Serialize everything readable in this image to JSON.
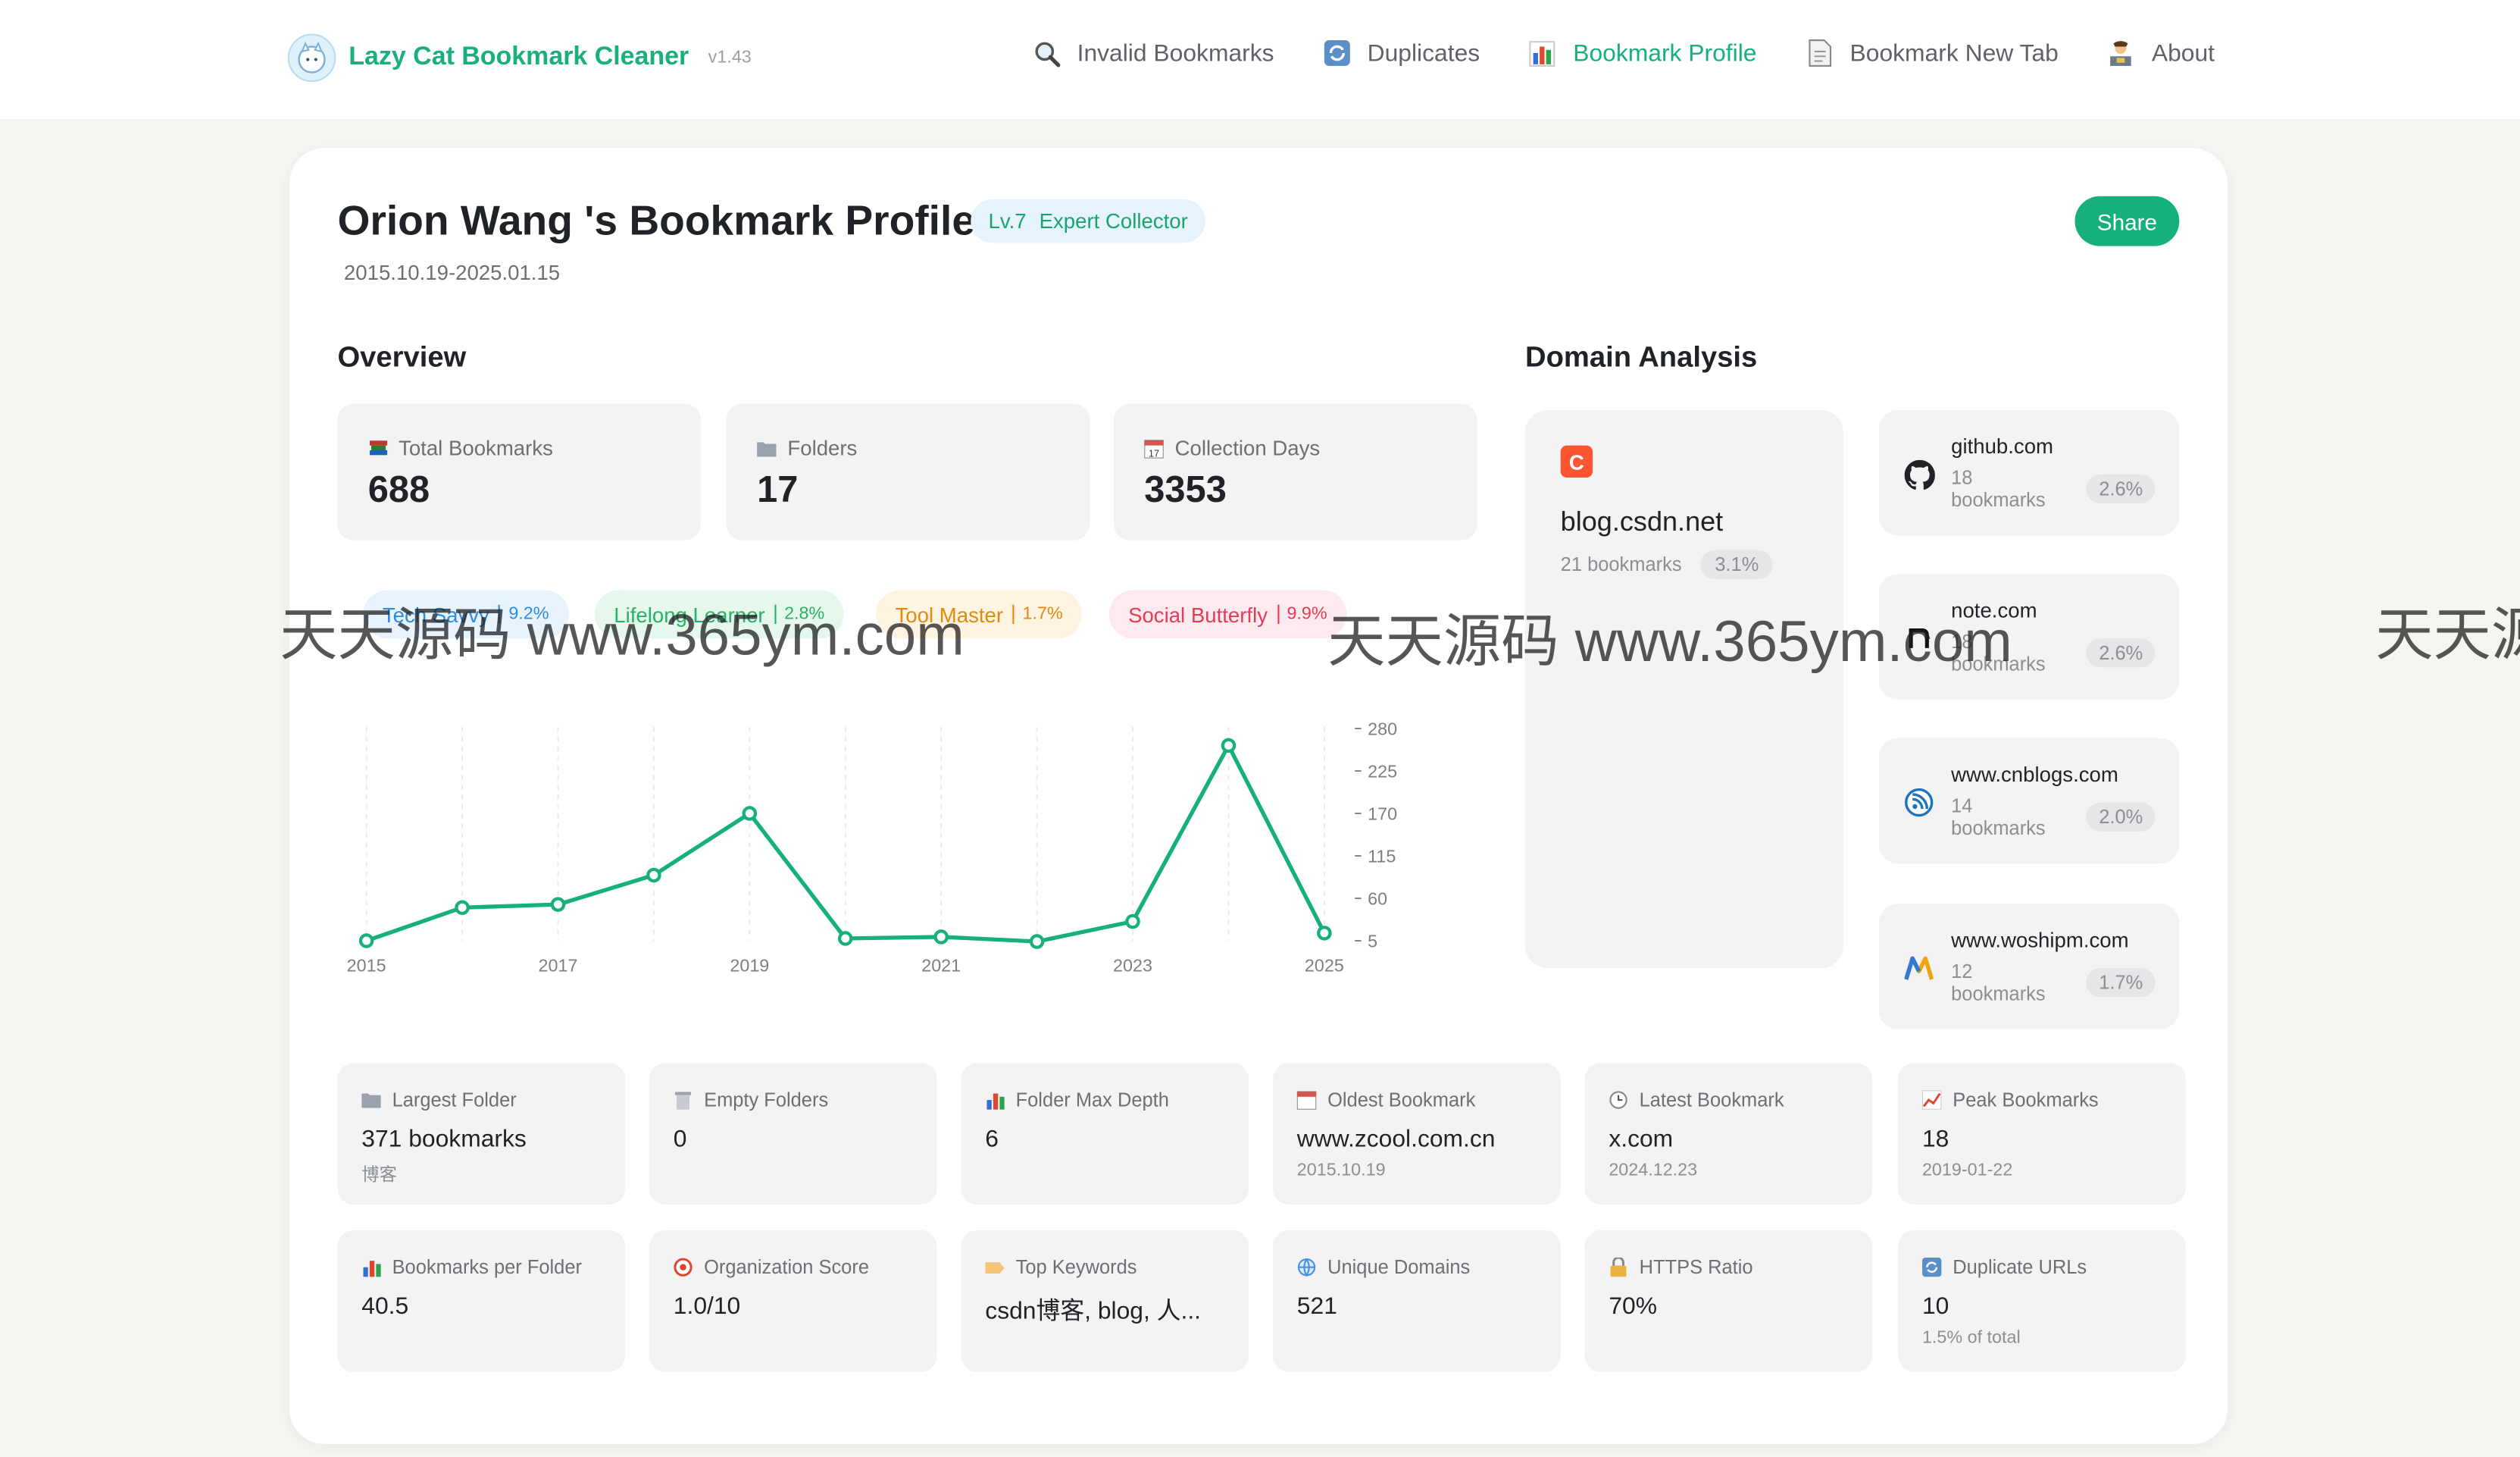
{
  "colors": {
    "accent": "#16b07a",
    "background": "#f6f5f2",
    "card": "#ffffff",
    "tile": "#f3f3f4"
  },
  "header": {
    "app_name": "Lazy Cat Bookmark Cleaner",
    "version": "v1.43",
    "logo_icon": "cat-mascot-icon",
    "nav": [
      {
        "label": "Invalid Bookmarks",
        "icon": "magnifier-icon",
        "active": false
      },
      {
        "label": "Duplicates",
        "icon": "refresh-icon",
        "active": false
      },
      {
        "label": "Bookmark Profile",
        "icon": "bar-chart-icon",
        "active": true
      },
      {
        "label": "Bookmark New Tab",
        "icon": "page-icon",
        "active": false
      },
      {
        "label": "About",
        "icon": "person-at-desk-icon",
        "active": false
      }
    ]
  },
  "profile": {
    "title": "Orion Wang 's Bookmark Profile",
    "level": "Lv.7",
    "level_title": "Expert Collector",
    "date_range": "2015.10.19-2025.01.15",
    "share_label": "Share"
  },
  "overview": {
    "heading": "Overview",
    "stats": [
      {
        "label": "Total Bookmarks",
        "value": "688",
        "icon": "books-icon"
      },
      {
        "label": "Folders",
        "value": "17",
        "icon": "folder-icon"
      },
      {
        "label": "Collection Days",
        "value": "3353",
        "icon": "calendar-icon"
      }
    ],
    "tags": [
      {
        "label": "Tech Savvy",
        "pct": "9.2%",
        "color": "#2b8de0",
        "bg": "#e8f3fd"
      },
      {
        "label": "Lifelong Learner",
        "pct": "2.8%",
        "color": "#26b267",
        "bg": "#e6f7ec"
      },
      {
        "label": "Tool Master",
        "pct": "1.7%",
        "color": "#e08a12",
        "bg": "#fff4e2"
      },
      {
        "label": "Social Butterfly",
        "pct": "9.9%",
        "color": "#e33c5a",
        "bg": "#fdeaee"
      }
    ]
  },
  "chart_data": {
    "type": "line",
    "x": [
      2015,
      2016,
      2017,
      2018,
      2019,
      2020,
      2021,
      2022,
      2023,
      2024,
      2025
    ],
    "values": [
      5,
      48,
      52,
      90,
      170,
      8,
      10,
      4,
      30,
      258,
      15
    ],
    "x_tick_labels": [
      "2015",
      "2017",
      "2019",
      "2021",
      "2023",
      "2025"
    ],
    "y_tick_labels": [
      "280",
      "225",
      "170",
      "115",
      "60",
      "5"
    ],
    "ylim": [
      5,
      280
    ],
    "y_axis_position": "right",
    "grid": "vertical dashed",
    "line_color": "#16b07a"
  },
  "domains": {
    "heading": "Domain Analysis",
    "top": {
      "name": "blog.csdn.net",
      "count": "21 bookmarks",
      "pct": "3.1%",
      "icon": "csdn-logo-icon",
      "logo_letter": "C"
    },
    "others": [
      {
        "name": "github.com",
        "count": "18",
        "unit": "bookmarks",
        "pct": "2.6%",
        "icon": "github-icon"
      },
      {
        "name": "note.com",
        "count": "18",
        "unit": "bookmarks",
        "pct": "2.6%",
        "icon": "note-icon"
      },
      {
        "name": "www.cnblogs.com",
        "count": "14",
        "unit": "bookmarks",
        "pct": "2.0%",
        "icon": "cnblogs-icon"
      },
      {
        "name": "www.woshipm.com",
        "count": "12",
        "unit": "bookmarks",
        "pct": "1.7%",
        "icon": "woshipm-icon"
      }
    ]
  },
  "details": [
    {
      "label": "Largest Folder",
      "value": "371 bookmarks",
      "sub": "博客",
      "icon": "folder-icon"
    },
    {
      "label": "Empty Folders",
      "value": "0",
      "sub": "",
      "icon": "trash-icon"
    },
    {
      "label": "Folder Max Depth",
      "value": "6",
      "sub": "",
      "icon": "bar-chart-icon"
    },
    {
      "label": "Oldest Bookmark",
      "value": "www.zcool.com.cn",
      "sub": "2015.10.19",
      "icon": "calendar-icon"
    },
    {
      "label": "Latest Bookmark",
      "value": "x.com",
      "sub": "2024.12.23",
      "icon": "clock-icon"
    },
    {
      "label": "Peak Bookmarks",
      "value": "18",
      "sub": "2019-01-22",
      "icon": "trend-up-icon"
    },
    {
      "label": "Bookmarks per Folder",
      "value": "40.5",
      "sub": "",
      "icon": "bar-chart-icon"
    },
    {
      "label": "Organization Score",
      "value": "1.0/10",
      "sub": "",
      "icon": "target-icon"
    },
    {
      "label": "Top Keywords",
      "value": "csdn博客, blog, 人...",
      "sub": "",
      "icon": "tag-icon"
    },
    {
      "label": "Unique Domains",
      "value": "521",
      "sub": "",
      "icon": "globe-icon"
    },
    {
      "label": "HTTPS Ratio",
      "value": "70%",
      "sub": "",
      "icon": "lock-icon"
    },
    {
      "label": "Duplicate URLs",
      "value": "10",
      "sub": "1.5% of total",
      "icon": "refresh-icon"
    }
  ],
  "watermark": "天天源码 www.365ym.com",
  "watermark_partial": "天天源"
}
